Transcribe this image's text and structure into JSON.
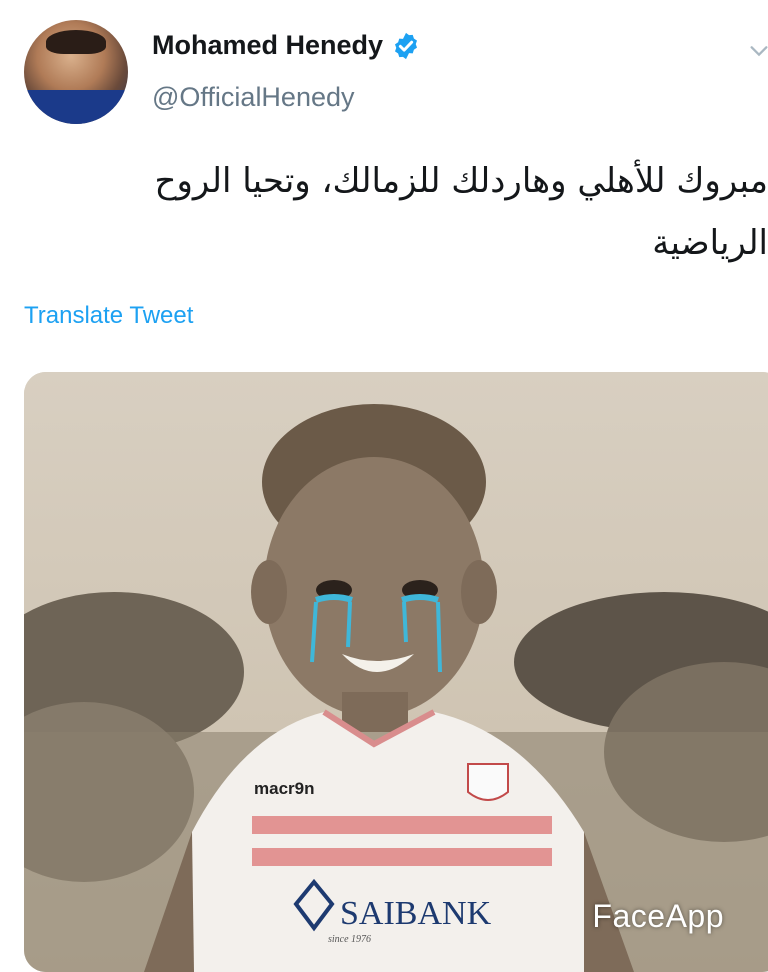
{
  "tweet": {
    "author": {
      "display_name": "Mohamed Henedy",
      "handle": "@OfficialHenedy",
      "verified": true,
      "avatar_icon": "profile-photo"
    },
    "text": "مبروك للأهلي وهاردلك للزمالك، وتحيا الروح\nالرياضية",
    "translate_label": "Translate Tweet",
    "menu_icon": "chevron-down-icon",
    "media": {
      "description_icon": "photo",
      "shirt_brand": "macr9n",
      "sponsor": "SAIBANK",
      "sponsor_sub": "since 1976",
      "watermark": "FaceApp"
    }
  },
  "colors": {
    "link": "#1da1f2",
    "verified_badge": "#1da1f2",
    "handle_gray": "#657786",
    "text_dark": "#14171a",
    "tears": "#3fb7d9",
    "shirt_stripe": "#e08a8a"
  }
}
